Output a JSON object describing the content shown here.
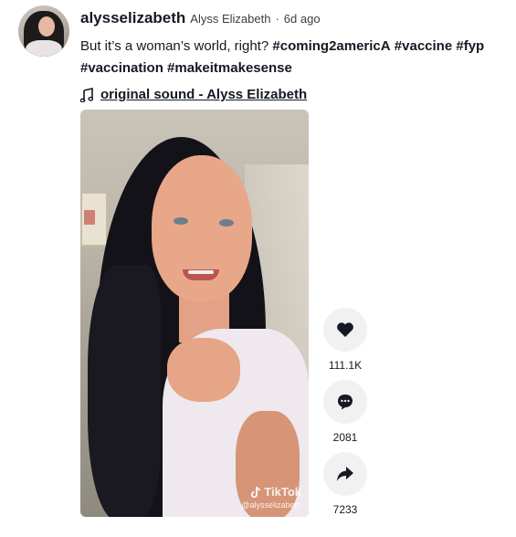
{
  "post": {
    "username": "alysselizabeth",
    "nickname": "Alyss Elizabeth",
    "separator": "·",
    "time_ago": "6d ago",
    "caption_text": "But it’s a woman’s world, right?",
    "hashtags": [
      "#coming2americA",
      "#vaccine",
      "#fyp",
      "#vaccination",
      "#makeitmakesense"
    ],
    "sound": "original sound - Alyss Elizabeth"
  },
  "video": {
    "watermark_brand": "TikTok",
    "watermark_handle": "@alysselizabeth"
  },
  "actions": {
    "likes": "111.1K",
    "comments": "2081",
    "shares": "7233"
  },
  "icons": {
    "like": "heart-icon",
    "comment": "comment-icon",
    "share": "share-icon",
    "music": "music-note-icon",
    "tiktok": "tiktok-logo-icon"
  }
}
